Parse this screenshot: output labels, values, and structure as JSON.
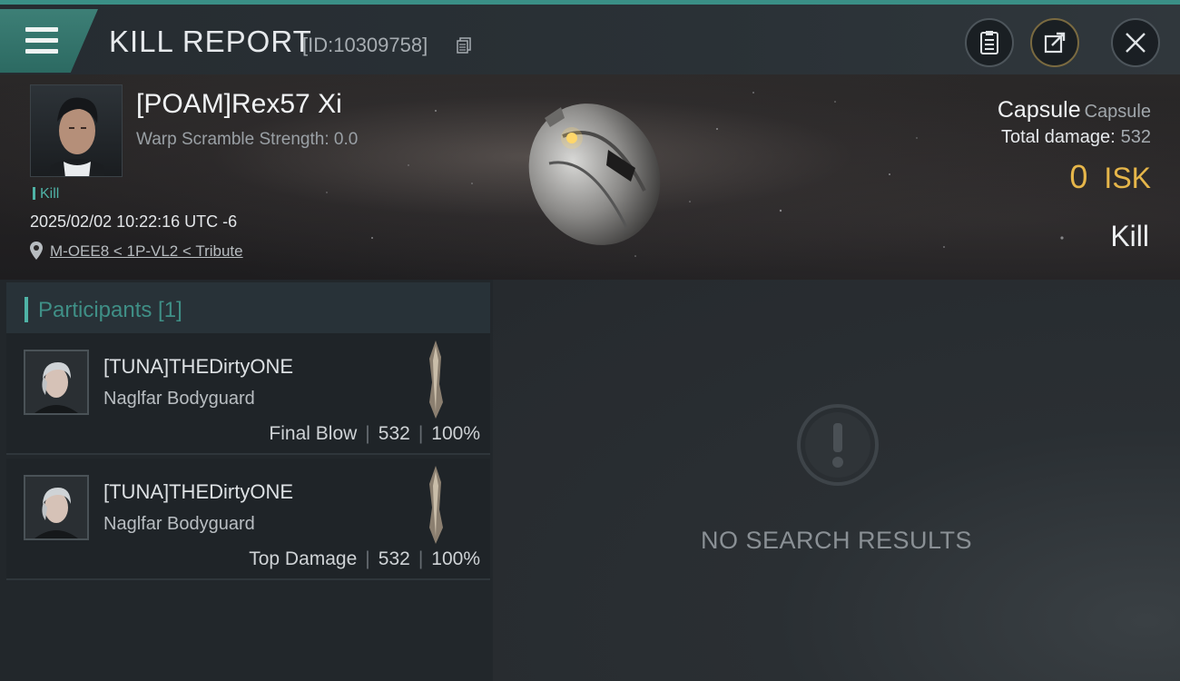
{
  "header": {
    "menu_icon": "hamburger-menu-icon",
    "title": "KILL REPORT",
    "kill_id": "[ID:10309758]",
    "copy_icon": "copy-icon",
    "report_icon": "clipboard-icon",
    "share_icon": "share-icon",
    "close_icon": "close-icon",
    "accent_color": "#3a8f86"
  },
  "victim": {
    "name": "[POAM]Rex57 Xi",
    "warp_scramble": "Warp Scramble Strength: 0.0",
    "tag": "Kill",
    "datetime": "2025/02/02 10:22:16 UTC -6",
    "location": "M-OEE8 < 1P-VL2 < Tribute",
    "ship_name": "Capsule",
    "ship_class": "Capsule",
    "total_damage_label": "Total damage:",
    "total_damage_value": "532",
    "isk_value": "0",
    "isk_unit": "ISK",
    "result": "Kill",
    "isk_color": "#e6b64a"
  },
  "participants": {
    "title": "Participants [1]",
    "rows": [
      {
        "name": "[TUNA]THEDirtyONE",
        "ship": "Naglfar Bodyguard",
        "role": "Final Blow",
        "damage": "532",
        "percent": "100%"
      },
      {
        "name": "[TUNA]THEDirtyONE",
        "ship": "Naglfar Bodyguard",
        "role": "Top Damage",
        "damage": "532",
        "percent": "100%"
      }
    ]
  },
  "results": {
    "empty_icon": "exclamation-circle-icon",
    "empty_text": "NO SEARCH RESULTS"
  }
}
